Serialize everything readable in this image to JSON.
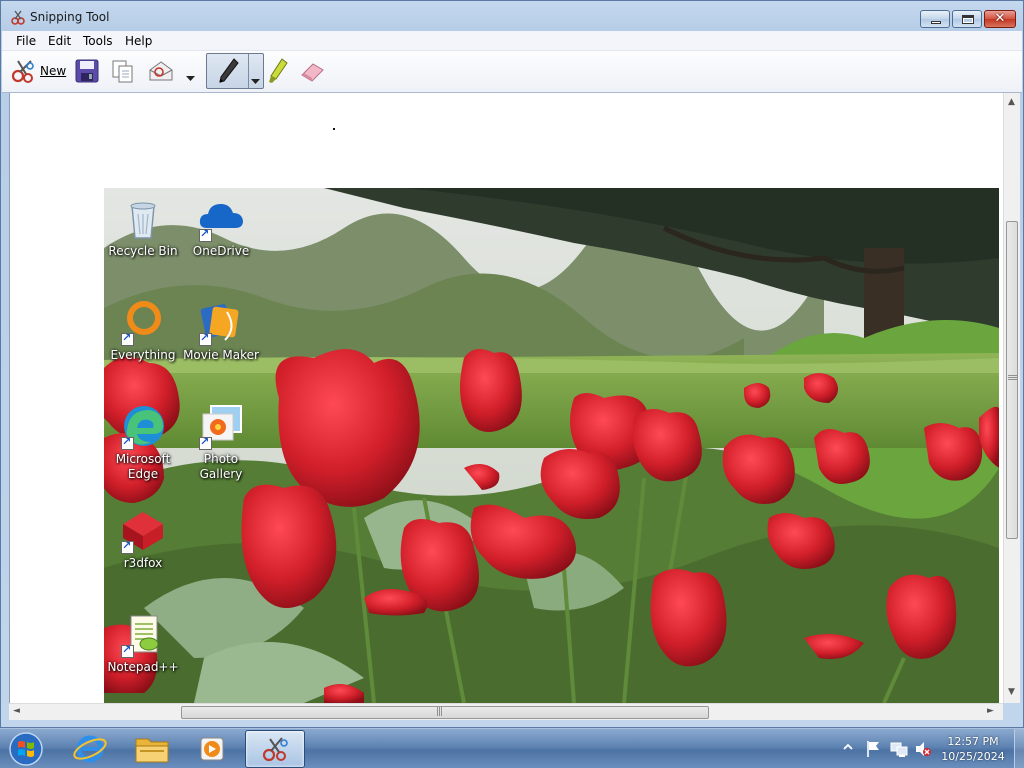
{
  "window": {
    "title": "Snipping Tool",
    "close_glyph": "✕"
  },
  "menu": {
    "file": "File",
    "edit": "Edit",
    "tools": "Tools",
    "help": "Help"
  },
  "toolbar": {
    "new_label": "New",
    "icons": [
      "scissors-icon",
      "save-icon",
      "copy-icon",
      "send-snip-icon",
      "pen-icon",
      "highlighter-icon",
      "eraser-icon"
    ]
  },
  "desktop_icons": [
    {
      "label": "Recycle Bin",
      "icon": "recycle-bin-icon"
    },
    {
      "label": "OneDrive",
      "icon": "onedrive-icon"
    },
    {
      "label": "Everything",
      "icon": "everything-icon"
    },
    {
      "label": "Movie Maker",
      "icon": "movie-maker-icon"
    },
    {
      "label": "Microsoft Edge",
      "icon": "edge-icon"
    },
    {
      "label": "Photo Gallery",
      "icon": "photo-gallery-icon"
    },
    {
      "label": "r3dfox",
      "icon": "r3dfox-icon"
    },
    {
      "label": "Notepad++",
      "icon": "notepad-plus-plus-icon"
    }
  ],
  "taskbar": {
    "apps": [
      "internet-explorer-icon",
      "file-explorer-icon",
      "media-player-icon",
      "snipping-tool-icon"
    ],
    "clock_time": "12:57 PM",
    "clock_date": "10/25/2024"
  },
  "scroll": {
    "up": "▲",
    "down": "▼",
    "left": "◄",
    "right": "►",
    "grip": "|||"
  },
  "colors": {
    "tulip_red": "#d11f2a",
    "grass": "#7fa24c",
    "titlebar": "#c4d8ee",
    "taskbar": "#5f84b3"
  }
}
